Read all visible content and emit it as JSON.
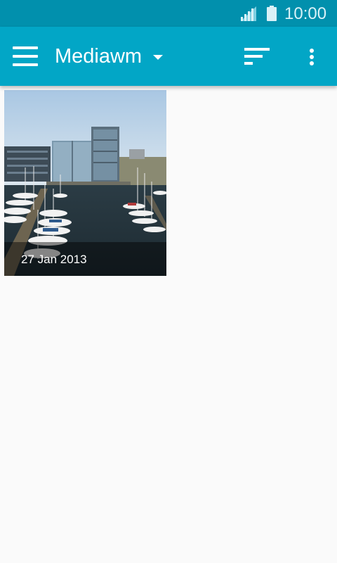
{
  "status_bar": {
    "time": "10:00",
    "signal_icon": "signal-icon",
    "battery_icon": "battery-icon",
    "background_color": "#0190ad"
  },
  "app_bar": {
    "title": "Mediawm",
    "menu_icon": "hamburger-menu-icon",
    "dropdown_icon": "caret-down-icon",
    "sort_icon": "sort-icon",
    "more_icon": "more-vert-icon",
    "background_color": "#02a6c6"
  },
  "gallery": {
    "items": [
      {
        "date": "27 Jan 2013",
        "image": "marina-photo-thumbnail"
      }
    ]
  }
}
